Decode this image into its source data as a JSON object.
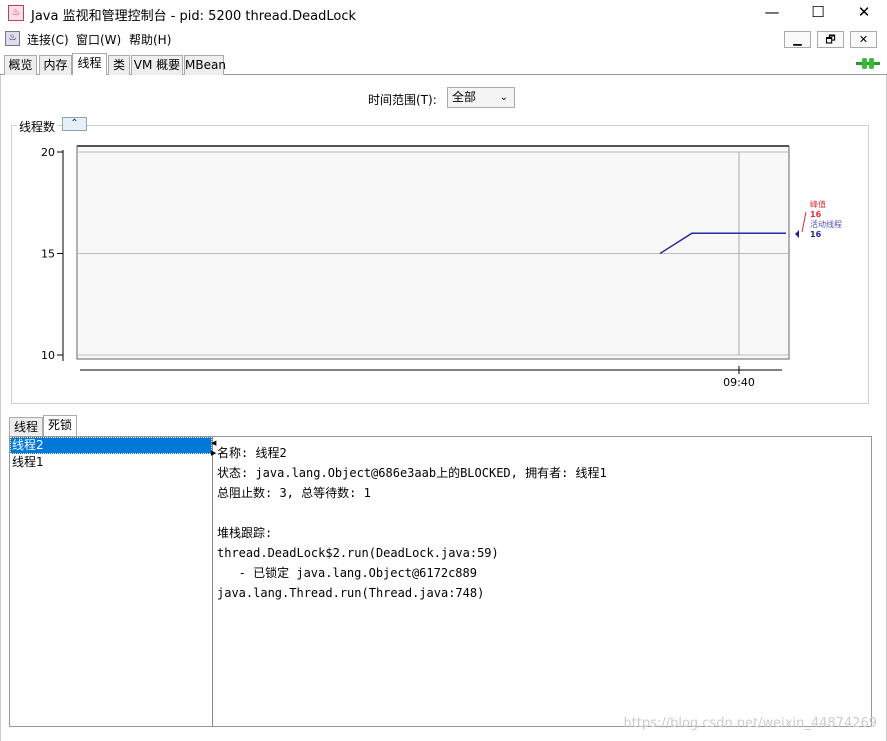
{
  "window": {
    "title": "Java 监视和管理控制台 - pid: 5200 thread.DeadLock",
    "minimize": "—",
    "maximize": "☐",
    "close": "✕"
  },
  "menu": {
    "items": [
      "连接(C)",
      "窗口(W)",
      "帮助(H)"
    ],
    "inner_buttons": [
      "▁",
      "🗗",
      "✕"
    ]
  },
  "tabs": [
    "概览",
    "内存",
    "线程",
    "类",
    "VM 概要",
    "MBean"
  ],
  "active_tab": 2,
  "time_range": {
    "label": "时间范围(T):",
    "value": "全部"
  },
  "panel": {
    "title": "线程数"
  },
  "chart_data": {
    "type": "line",
    "ylim": [
      10,
      20
    ],
    "yticks": [
      "20",
      "15",
      "10"
    ],
    "xticks": [
      "09:40"
    ],
    "series": [
      {
        "name": "峰值",
        "values": [
          15,
          16,
          16
        ],
        "color": "#e03030",
        "label_value": "16"
      },
      {
        "name": "活动线程",
        "values": [
          15,
          16,
          16
        ],
        "color": "#2020a0",
        "label_value": "16"
      }
    ]
  },
  "subtabs": [
    "线程",
    "死锁"
  ],
  "active_subtab": 1,
  "threads": [
    "线程2",
    "线程1"
  ],
  "detail_lines": [
    "名称: 线程2",
    "状态: java.lang.Object@686e3aab上的BLOCKED, 拥有者: 线程1",
    "总阻止数: 3, 总等待数: 1",
    "",
    "堆栈跟踪:",
    "thread.DeadLock$2.run(DeadLock.java:59)",
    "   - 已锁定 java.lang.Object@6172c889",
    "java.lang.Thread.run(Thread.java:748)"
  ],
  "watermark": "https://blog.csdn.net/weixin_44874269"
}
